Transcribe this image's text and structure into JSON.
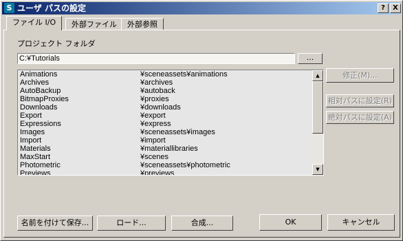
{
  "window": {
    "title": "ユーザ パスの設定",
    "help_label": "?",
    "close_label": "X"
  },
  "tabs": [
    {
      "label": "ファイル I/O",
      "active": true
    },
    {
      "label": "外部ファイル",
      "active": false
    },
    {
      "label": "外部参照",
      "active": false
    }
  ],
  "project": {
    "folder_label": "プロジェクト フォルダ",
    "folder_value": "C:¥Tutorials",
    "browse_label": "..."
  },
  "list": {
    "rows": [
      {
        "name": "Animations",
        "path": "¥sceneassets¥animations"
      },
      {
        "name": "Archives",
        "path": "¥archives"
      },
      {
        "name": "AutoBackup",
        "path": "¥autoback"
      },
      {
        "name": "BitmapProxies",
        "path": "¥proxies"
      },
      {
        "name": "Downloads",
        "path": "¥downloads"
      },
      {
        "name": "Export",
        "path": "¥export"
      },
      {
        "name": "Expressions",
        "path": "¥express"
      },
      {
        "name": "Images",
        "path": "¥sceneassets¥images"
      },
      {
        "name": "Import",
        "path": "¥import"
      },
      {
        "name": "Materials",
        "path": "¥materiallibraries"
      },
      {
        "name": "MaxStart",
        "path": "¥scenes"
      },
      {
        "name": "Photometric",
        "path": "¥sceneassets¥photometric"
      },
      {
        "name": "Previews",
        "path": "¥previews"
      }
    ],
    "scroll_up_glyph": "▲",
    "scroll_down_glyph": "▼"
  },
  "side_buttons": {
    "modify": "修正(M)...",
    "make_relative": "相対パスに設定(R)",
    "make_absolute": "絶対パスに設定(A)"
  },
  "bottom_buttons": {
    "save_as": "名前を付けて保存...",
    "load": "ロード...",
    "merge": "合成...",
    "ok": "OK",
    "cancel": "キャンセル"
  }
}
